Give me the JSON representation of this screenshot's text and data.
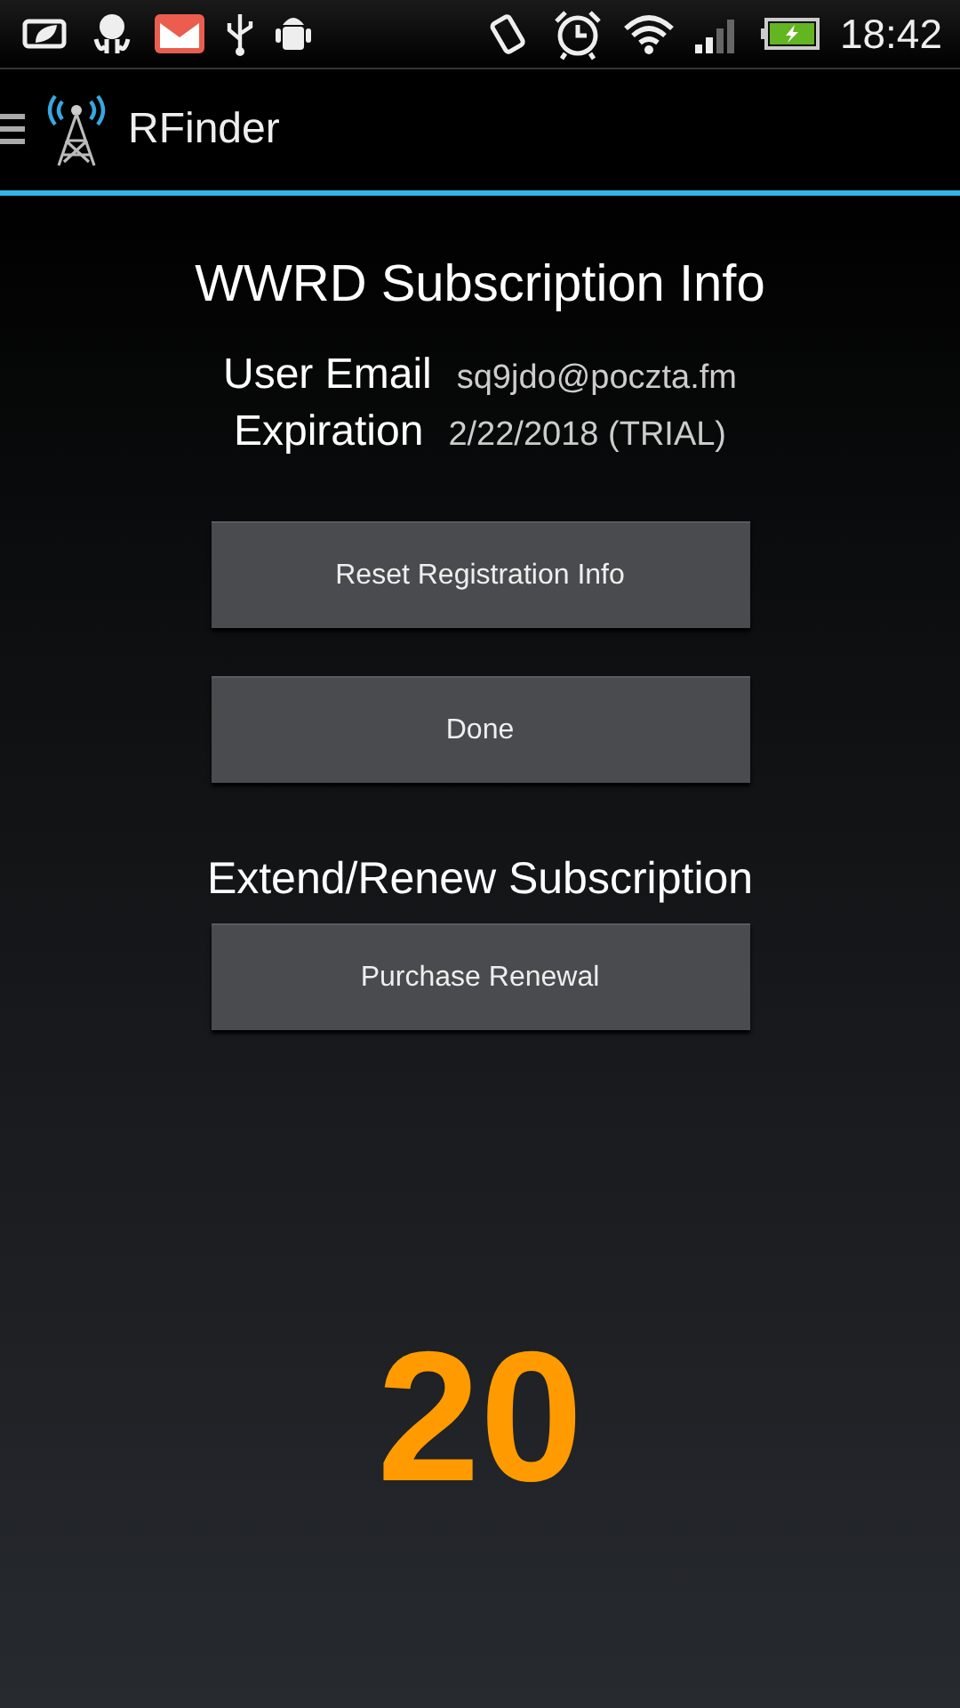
{
  "status_bar": {
    "time": "18:42"
  },
  "app_bar": {
    "title": "RFinder"
  },
  "heading": "WWRD Subscription Info",
  "info": [
    {
      "label": "User Email",
      "value": "sq9jdo@poczta.fm"
    },
    {
      "label": "Expiration",
      "value": "2/22/2018 (TRIAL)"
    }
  ],
  "buttons": [
    "Reset Registration Info",
    "Done"
  ],
  "renew": {
    "heading": "Extend/Renew Subscription",
    "button": "Purchase Renewal"
  },
  "big_number": "20"
}
